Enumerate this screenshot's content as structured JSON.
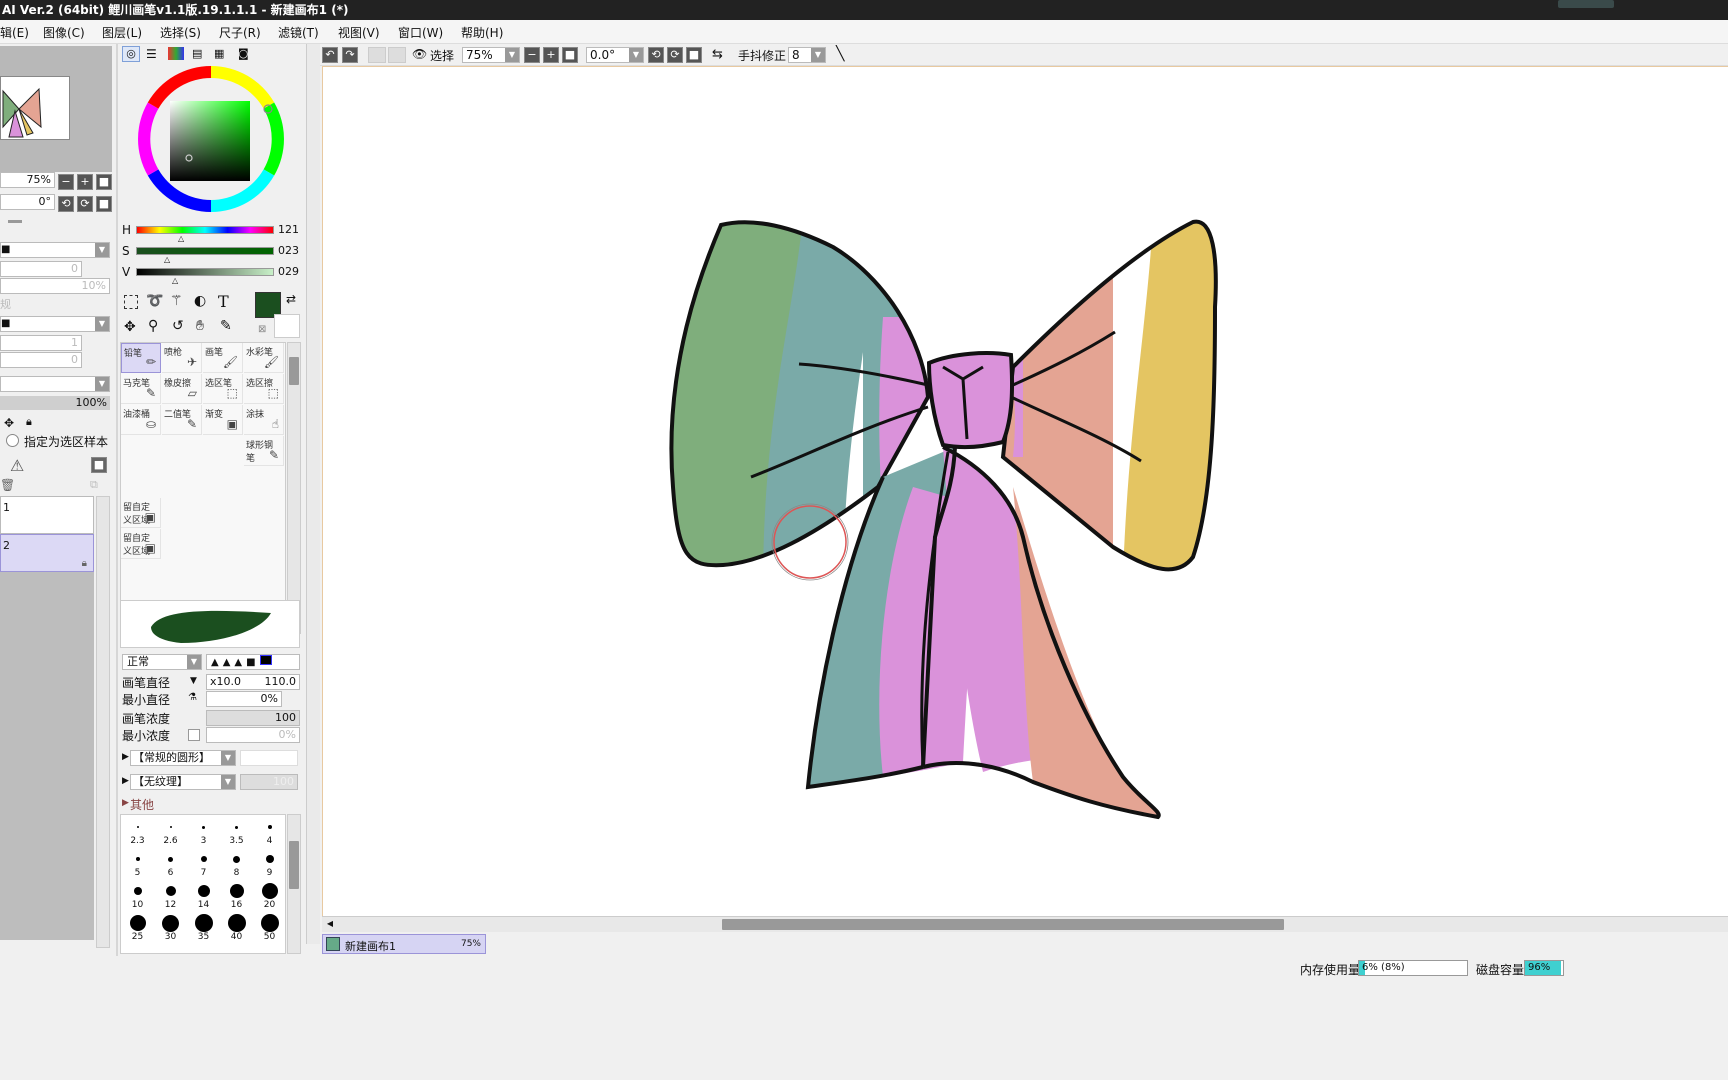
{
  "window": {
    "title": "AI Ver.2 (64bit) 鲤川画笔v1.1版.19.1.1.1 - 新建画布1 (*)"
  },
  "menu": [
    "辑(E)",
    "图像(C)",
    "图层(L)",
    "选择(S)",
    "尺子(R)",
    "滤镜(T)",
    "视图(V)",
    "窗口(W)",
    "帮助(H)"
  ],
  "navigator": {
    "zoom": "75%",
    "rotation": "0°"
  },
  "layers_panel": {
    "value_field_1": "0",
    "value_field_2": "10%",
    "value_field_3": "1",
    "value_field_4": "0",
    "opacity": "100%",
    "select_as_source_label": "指定为选区样本",
    "layers": [
      {
        "name": "1",
        "selected": false
      },
      {
        "name": "2",
        "selected": true
      }
    ]
  },
  "color": {
    "h_label": "H",
    "h_value": "121",
    "s_label": "S",
    "s_value": "023",
    "v_label": "V",
    "v_value": "029",
    "main_color": "#1b4f1f"
  },
  "tools": [
    {
      "label": "铅笔",
      "icon": "pencil-icon"
    },
    {
      "label": "喷枪",
      "icon": "airbrush-icon"
    },
    {
      "label": "画笔",
      "icon": "brush-icon"
    },
    {
      "label": "水彩笔",
      "icon": "watercolor-icon"
    },
    {
      "label": "马克笔",
      "icon": "marker-icon"
    },
    {
      "label": "橡皮擦",
      "icon": "eraser-icon"
    },
    {
      "label": "选区笔",
      "icon": "selpen-icon"
    },
    {
      "label": "选区擦",
      "icon": "selerase-icon"
    },
    {
      "label": "油漆桶",
      "icon": "bucket-icon"
    },
    {
      "label": "二值笔",
      "icon": "binary-pen-icon"
    },
    {
      "label": "渐变",
      "icon": "gradient-icon"
    },
    {
      "label": "涂抹",
      "icon": "smudge-icon"
    },
    {
      "label": "球形钢笔",
      "icon": "ball-pen-icon"
    },
    {
      "label": "留自定义区域",
      "icon": "custom-area-icon"
    },
    {
      "label": "留自定义区域",
      "icon": "custom-area-icon"
    }
  ],
  "brush": {
    "blend_mode": "正常",
    "size_label": "画笔直径",
    "size_multiplier": "x10.0",
    "size_value": "110.0",
    "min_size_label": "最小直径",
    "min_size_value": "0%",
    "density_label": "画笔浓度",
    "density_value": "100",
    "min_density_label": "最小浓度",
    "min_density_value": "0%",
    "shape_select": "【常规的圆形】",
    "texture_select": "【无纹理】",
    "texture_strength": "100",
    "other_label": "其他",
    "sizes": [
      "2.3",
      "2.6",
      "3",
      "3.5",
      "4",
      "5",
      "6",
      "7",
      "8",
      "9",
      "10",
      "12",
      "14",
      "16",
      "20",
      "25",
      "30",
      "35",
      "40",
      "50"
    ]
  },
  "toolbar": {
    "select_label": "选择",
    "zoom": "75%",
    "rotation": "0.0°",
    "stabilizer_label": "手抖修正",
    "stabilizer_value": "8"
  },
  "canvas_tab": {
    "name": "新建画布1",
    "zoom": "75%"
  },
  "status": {
    "memory_label": "内存使用量",
    "memory_value": "6% (8%)",
    "memory_fraction": 0.06,
    "disk_label": "磁盘容量",
    "disk_value": "96%",
    "disk_fraction": 0.96
  },
  "bow_colors": {
    "green": "#7fae7c",
    "teal": "#7aaaa8",
    "pink": "#da92da",
    "salmon": "#e4a493",
    "yellow": "#e4c562"
  }
}
